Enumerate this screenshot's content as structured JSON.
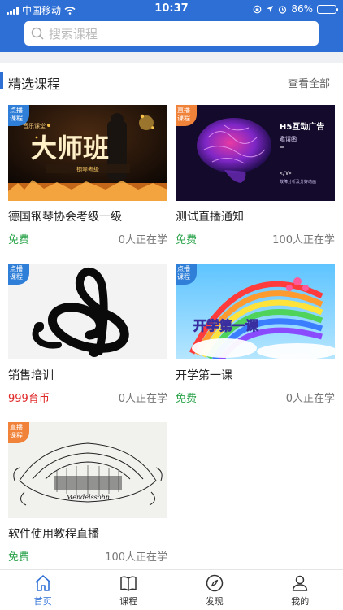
{
  "status_bar": {
    "carrier": "中国移动",
    "time": "10:37",
    "battery": "86%",
    "battery_level": 0.86
  },
  "search": {
    "placeholder": "搜索课程"
  },
  "section": {
    "title": "精选课程",
    "more": "查看全部"
  },
  "badges": {
    "vod": [
      "点播",
      "课程"
    ],
    "live": [
      "直播",
      "课程"
    ]
  },
  "courses": [
    {
      "title": "德国钢琴协会考级一级",
      "price": "免费",
      "learners": "0人正在学",
      "type": "vod",
      "thumb": {
        "big_text": "大师班",
        "small_text": "音乐课堂",
        "strip_text": "钢琴考级"
      }
    },
    {
      "title": "测试直播通知",
      "price": "免费",
      "learners": "100人正在学",
      "type": "live",
      "thumb": {
        "heading": "H5互动广告",
        "sub": "邀请函",
        "tag": "</V>",
        "note": "故障分析及分好动画"
      }
    },
    {
      "title": "销售培训",
      "price": "999育币",
      "learners": "0人正在学",
      "type": "vod",
      "thumb": {}
    },
    {
      "title": "开学第一课",
      "price": "免费",
      "learners": "0人正在学",
      "type": "vod",
      "thumb": {
        "text": "开学第一课"
      }
    },
    {
      "title": "软件使用教程直播",
      "price": "免费",
      "learners": "100人正在学",
      "type": "live",
      "thumb": {
        "script": "Mendelssohn"
      }
    }
  ],
  "tabs": [
    {
      "label": "首页",
      "icon": "home-icon",
      "active": true
    },
    {
      "label": "课程",
      "icon": "book-icon",
      "active": false
    },
    {
      "label": "发现",
      "icon": "compass-icon",
      "active": false
    },
    {
      "label": "我的",
      "icon": "user-icon",
      "active": false
    }
  ],
  "colors": {
    "primary": "#2e6fd6",
    "free": "#2aa34a",
    "paid": "#e02b2b",
    "vod_badge": "#2f7fd9",
    "live_badge": "#f0823a"
  }
}
